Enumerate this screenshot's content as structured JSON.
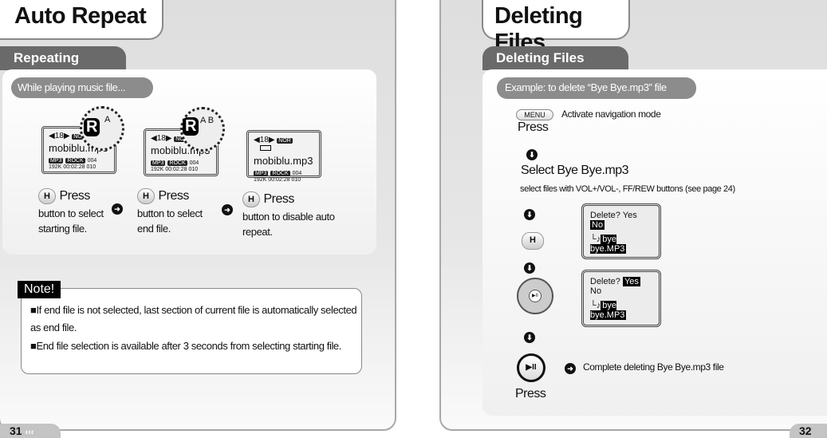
{
  "left_page": {
    "title": "Auto Repeat",
    "section": "Repeating",
    "context_pill": "While playing music file...",
    "screens": [
      {
        "status": "◀18▶",
        "eq": "NOR",
        "filename": "mobiblu.mp3",
        "format": "MP3",
        "genre": "ROCK",
        "track": "004",
        "bitrate": "192K",
        "time": "00:02:28",
        "total": "010",
        "magnifier_icon": "R",
        "magnifier_label": "A"
      },
      {
        "status": "◀18▶",
        "eq": "NOR",
        "filename": "mobiblu.mp3",
        "format": "MP3",
        "genre": "ROCK",
        "track": "004",
        "bitrate": "192K",
        "time": "00:02:28",
        "total": "010",
        "magnifier_icon": "R",
        "magnifier_label": "A B"
      },
      {
        "status": "◀18▶",
        "eq": "NOR",
        "filename": "mobiblu.mp3",
        "format": "MP3",
        "genre": "ROCK",
        "track": "004",
        "bitrate": "192K",
        "time": "00:02:28",
        "total": "010"
      }
    ],
    "steps": [
      {
        "button": "H",
        "press": "Press",
        "desc1": "button to select",
        "desc2": "starting file."
      },
      {
        "button": "H",
        "press": "Press",
        "desc1": "button to select",
        "desc2": "end file."
      },
      {
        "button": "H",
        "press": "Press",
        "desc1": "button to disable auto",
        "desc2": "repeat."
      }
    ],
    "note": {
      "badge": "Note!",
      "items": [
        "If end file is not selected, last section of current file is automatically selected as end file.",
        "End file selection is available after 3 seconds from selecting starting file."
      ]
    },
    "page_number": "31",
    "page_arrows": "‹‹‹"
  },
  "right_page": {
    "title": "Deleting Files",
    "section": "Deleting Files",
    "context_pill": "Example: to delete  “Bye Bye.mp3” file",
    "menu_button": "MENU",
    "menu_desc": "Activate navigation mode",
    "press1": "Press",
    "select_title": "Select Bye Bye.mp3",
    "select_desc": "select files with VOL+/VOL-, FF/REW buttons (see page 24)",
    "hold_button": "H",
    "dialog1": {
      "prompt": "Delete?",
      "yes": "Yes",
      "no": "No",
      "file": "bye bye.MP3",
      "selected": "No"
    },
    "dialog2": {
      "prompt": "Delete?",
      "yes": "Yes",
      "no": "No",
      "file": "bye bye.MP3",
      "selected": "Yes"
    },
    "play_symbol": "▶II",
    "complete_desc": "Complete deleting Bye Bye.mp3 file",
    "press2": "Press",
    "page_number": "32"
  },
  "colors": {
    "tab_dark": "#6a6a6a",
    "pill": "#8c8c8c",
    "panel": "#e0e0e0"
  }
}
